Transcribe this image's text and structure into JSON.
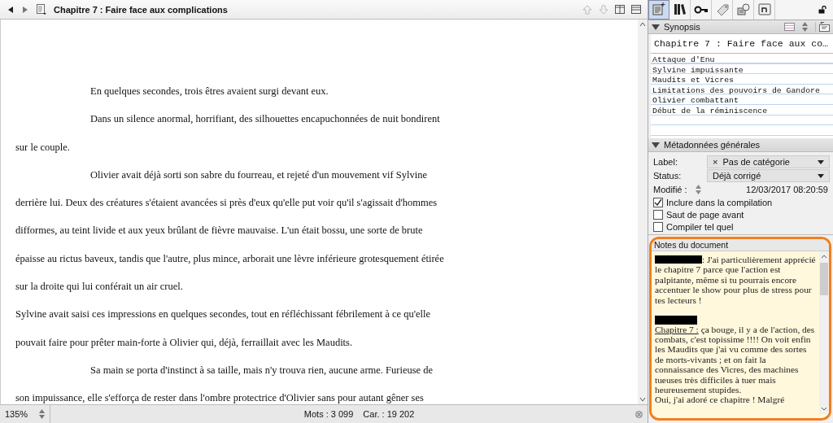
{
  "editor": {
    "title": "Chapitre 7 : Faire face aux complications",
    "paragraphs": [
      {
        "indent": true,
        "text": "En quelques secondes, trois êtres avaient surgi devant eux."
      },
      {
        "indent": true,
        "text": "Dans un silence anormal, horrifiant, des silhouettes encapuchonnées de nuit bondirent sur le couple."
      },
      {
        "indent": true,
        "text": "Olivier avait déjà sorti son sabre du fourreau, et rejeté d'un mouvement vif Sylvine derrière lui. Deux des créatures s'étaient avancées si près d'eux qu'elle put voir qu'il s'agissait d'hommes difformes, au teint livide et aux yeux brûlant de fièvre mauvaise. L'un était bossu, une sorte de brute épaisse au rictus baveux, tandis que l'autre, plus mince, arborait une lèvre inférieure grotesquement étirée sur la droite qui lui conférait un air cruel."
      },
      {
        "indent": false,
        "text": "Sylvine avait saisi ces impressions en quelques secondes, tout en réfléchissant fébrilement à ce qu'elle pouvait faire pour prêter main-forte à Olivier qui, déjà, ferraillait avec les Maudits."
      },
      {
        "indent": true,
        "text": "Sa main se porta d'instinct à sa taille, mais n'y trouva rien, aucune arme. Furieuse de son impuissance, elle s'efforça de rester dans l'ombre protectrice d'Olivier sans pour autant gêner ses"
      }
    ],
    "zoom": "135%",
    "words": "Mots : 3 099",
    "chars": "Car. : 19 202"
  },
  "inspector": {
    "tabs": [
      {
        "kind": "notes",
        "selected": true
      },
      {
        "kind": "books",
        "selected": false
      },
      {
        "kind": "key",
        "selected": false
      },
      {
        "kind": "tag",
        "selected": false
      },
      {
        "kind": "snapshot",
        "selected": false
      },
      {
        "kind": "footnote",
        "selected": false
      }
    ],
    "synopsis": {
      "header": "Synopsis",
      "title": "Chapitre 7 : Faire face aux co…",
      "lines": [
        "Attaque d'Enu",
        "Sylvine impuissante",
        "Maudits et Vicres",
        "Limitations des pouvoirs de Gandore",
        "Olivier combattant",
        "Début de la réminiscence"
      ]
    },
    "metadata": {
      "header": "Métadonnées générales",
      "label": {
        "caption": "Label:",
        "icon": "×",
        "value": "Pas de catégorie"
      },
      "status": {
        "caption": "Status:",
        "value": "Déjà corrigé"
      },
      "modified": {
        "caption": "Modifié :",
        "value": "12/03/2017 08:20:59"
      },
      "options": [
        {
          "label": "Inclure dans la compilation",
          "checked": true
        },
        {
          "label": "Saut de page avant",
          "checked": false
        },
        {
          "label": "Compiler tel quel",
          "checked": false
        }
      ]
    },
    "notes": {
      "header": "Notes du document",
      "blocks": [
        {
          "kind": "text",
          "redacted_lead": true,
          "text": ": J'ai particulièrement apprécié le chapitre 7 parce que l'action est palpitante, même si tu pourrais encore accentuer le show pour plus de stress pour tes lecteurs !"
        },
        {
          "kind": "redaction"
        },
        {
          "kind": "text",
          "redacted_lead": false,
          "underlined": "Chapitre 7 :",
          "text": " ça bouge, il y a de l'action, des combats, c'est topissime !!!! On voit enfin les Maudits que j'ai vu comme des sortes de morts-vivants ; et on fait la connaissance des Vicres, des machines tueuses très difficiles à tuer mais heureusement stupides."
        },
        {
          "kind": "text",
          "redacted_lead": false,
          "text": "Oui, j'ai adoré ce chapitre ! Malgré"
        }
      ]
    }
  }
}
